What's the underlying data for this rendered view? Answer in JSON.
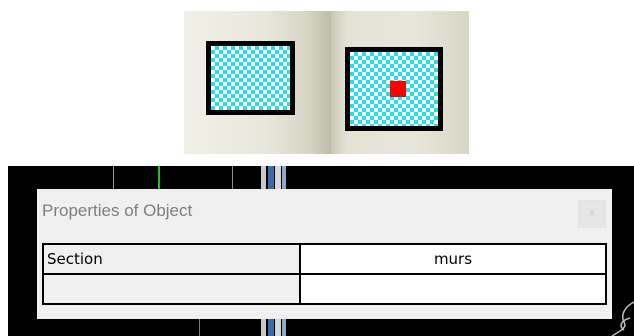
{
  "toolbar": {
    "buttons": [
      {
        "name": "fill-pattern-icon",
        "state": "default"
      },
      {
        "name": "fill-pattern-selected-icon",
        "state": "selected"
      }
    ],
    "colors": {
      "pattern_cyan": "#24e0ec",
      "selection_red": "#ff0000",
      "frame": "#000000"
    }
  },
  "dialog": {
    "title": "Properties of Object",
    "close_label": "x",
    "rows": [
      {
        "key": "Section",
        "value": "murs"
      },
      {
        "key": "",
        "value": ""
      }
    ]
  }
}
